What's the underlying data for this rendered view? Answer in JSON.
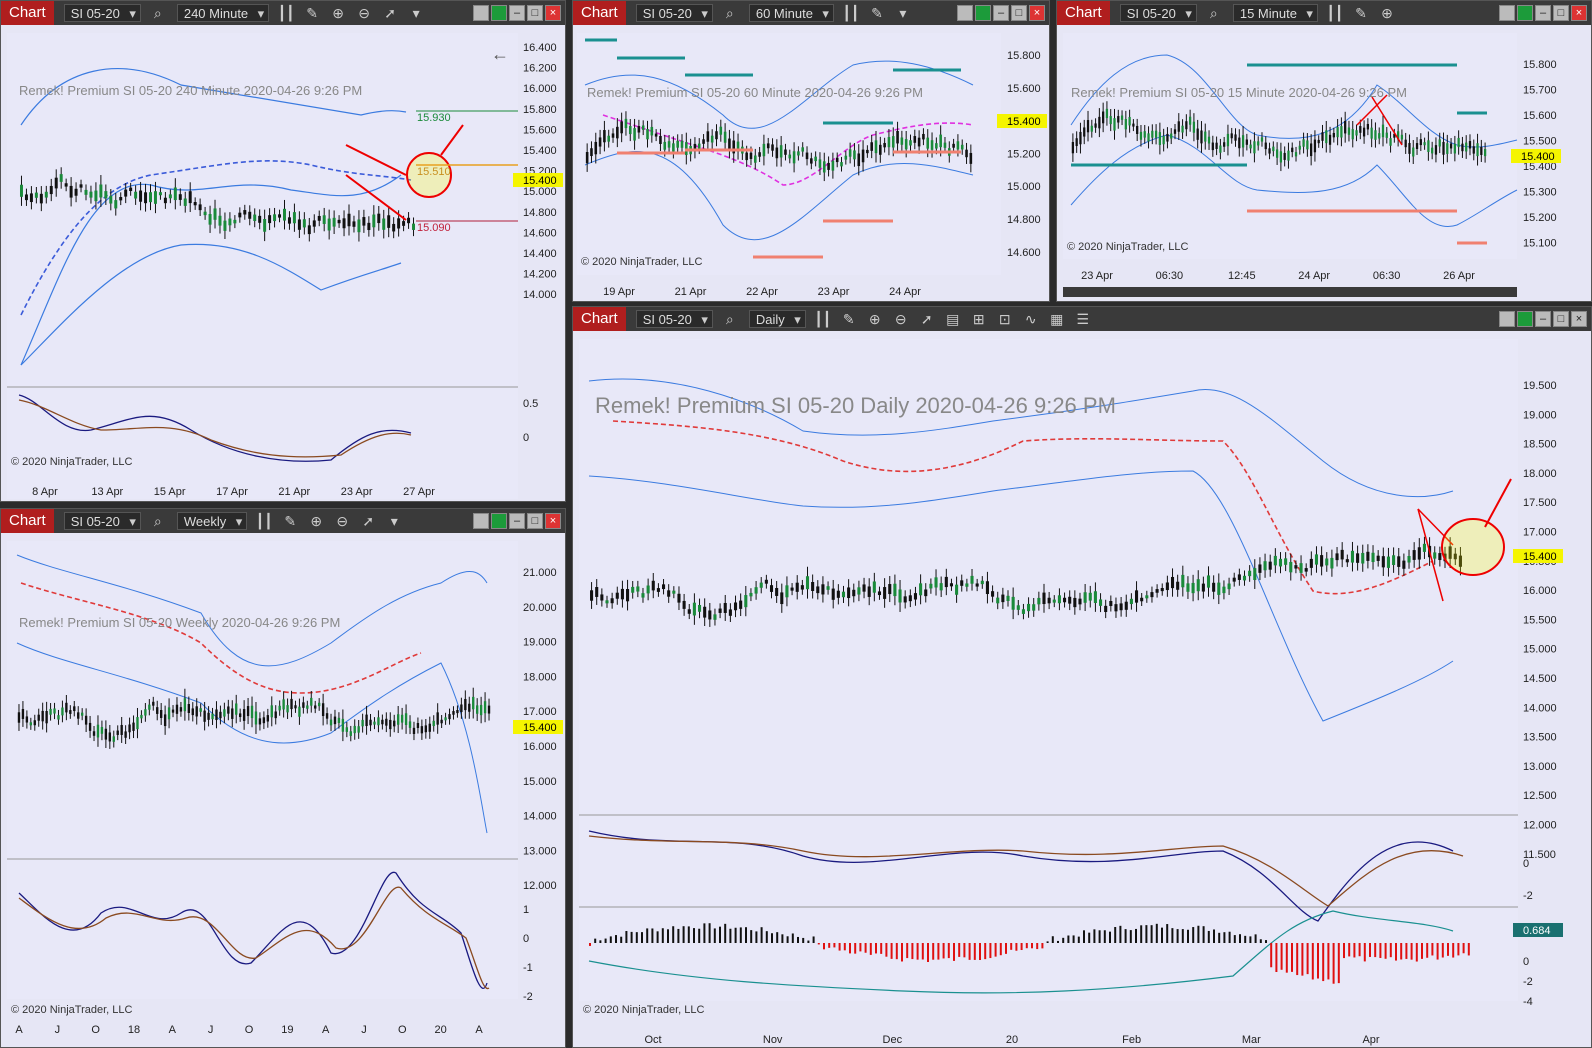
{
  "windows": [
    {
      "id": "w240",
      "title": "Chart",
      "symbol": "SI 05-20",
      "interval": "240 Minute",
      "watermark": "Remek!  Premium  SI 05-20  240 Minute  2020-04-26 9:26 PM",
      "copyright": "© 2020 NinjaTrader, LLC",
      "yticks": [
        "16.400",
        "16.200",
        "16.000",
        "15.800",
        "15.600",
        "15.400",
        "15.200",
        "15.000",
        "14.800",
        "14.600",
        "14.400",
        "14.200",
        "14.000"
      ],
      "osc_ticks": [
        "0.5",
        "0"
      ],
      "xticks": [
        "8 Apr",
        "13 Apr",
        "15 Apr",
        "17 Apr",
        "21 Apr",
        "23 Apr",
        "27 Apr"
      ],
      "price_tag": "15.400",
      "levels": {
        "upper": "15.930",
        "mid": "15.510",
        "lower": "15.090"
      }
    },
    {
      "id": "w60",
      "title": "Chart",
      "symbol": "SI 05-20",
      "interval": "60 Minute",
      "watermark": "Remek!  Premium  SI 05-20  60 Minute  2020-04-26 9:26 PM",
      "copyright": "© 2020 NinjaTrader, LLC",
      "yticks": [
        "15.800",
        "15.600",
        "15.400",
        "15.200",
        "15.000",
        "14.800",
        "14.600"
      ],
      "xticks": [
        "19 Apr",
        "21 Apr",
        "22 Apr",
        "23 Apr",
        "24 Apr"
      ],
      "price_tag": "15.400"
    },
    {
      "id": "w15",
      "title": "Chart",
      "symbol": "SI 05-20",
      "interval": "15 Minute",
      "watermark": "Remek!  Premium  SI 05-20  15 Minute  2020-04-26 9:26 PM",
      "copyright": "© 2020 NinjaTrader, LLC",
      "yticks": [
        "15.800",
        "15.700",
        "15.600",
        "15.500",
        "15.400",
        "15.300",
        "15.200",
        "15.100"
      ],
      "xticks": [
        "23 Apr",
        "06:30",
        "12:45",
        "24 Apr",
        "06:30",
        "26 Apr"
      ],
      "price_tag": "15.400"
    },
    {
      "id": "wW",
      "title": "Chart",
      "symbol": "SI 05-20",
      "interval": "Weekly",
      "watermark": "Remek!  Premium  SI 05-20  Weekly  2020-04-26 9:26 PM",
      "copyright": "© 2020 NinjaTrader, LLC",
      "yticks": [
        "21.000",
        "20.000",
        "19.000",
        "18.000",
        "17.000",
        "16.000",
        "15.000",
        "14.000",
        "13.000",
        "12.000"
      ],
      "osc_ticks": [
        "1",
        "0",
        "-1",
        "-2"
      ],
      "xticks": [
        "A",
        "J",
        "O",
        "18",
        "A",
        "J",
        "O",
        "19",
        "A",
        "J",
        "O",
        "20",
        "A"
      ],
      "price_tag": "15.400"
    },
    {
      "id": "wD",
      "title": "Chart",
      "symbol": "SI 05-20",
      "interval": "Daily",
      "watermark": "Remek!  Premium  SI 05-20  Daily  2020-04-26 9:26 PM",
      "copyright": "© 2020 NinjaTrader, LLC",
      "yticks": [
        "19.500",
        "19.000",
        "18.500",
        "18.000",
        "17.500",
        "17.000",
        "16.500",
        "16.000",
        "15.500",
        "15.000",
        "14.500",
        "14.000",
        "13.500",
        "13.000",
        "12.500",
        "12.000",
        "11.500"
      ],
      "osc_ticks": [
        "0",
        "-2"
      ],
      "hist_ticks": [
        "0",
        "-2",
        "-4"
      ],
      "hist_tag": "0.684",
      "xticks": [
        "Oct",
        "Nov",
        "Dec",
        "20",
        "Feb",
        "Mar",
        "Apr"
      ],
      "price_tag": "15.400"
    }
  ]
}
